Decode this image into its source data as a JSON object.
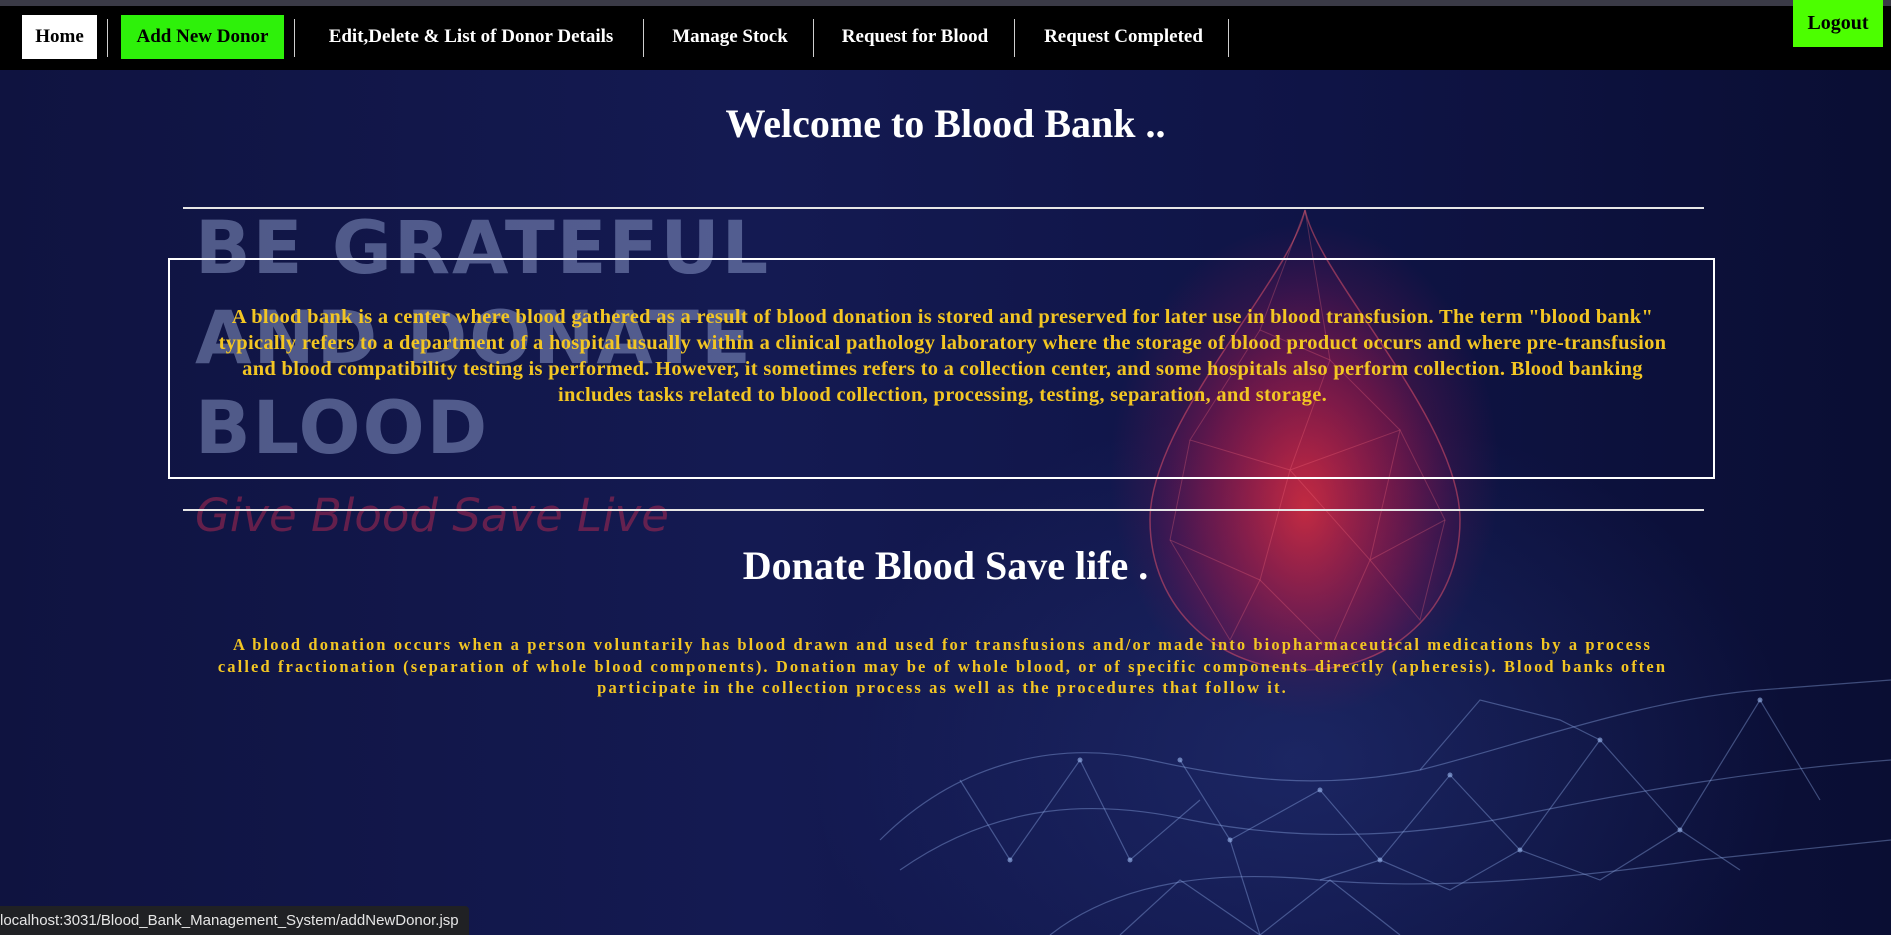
{
  "nav": {
    "home": "Home",
    "add_donor": "Add New Donor",
    "edit_donor": "Edit,Delete & List of Donor Details",
    "manage_stock": "Manage Stock",
    "request_blood": "Request for Blood",
    "request_completed": "Request Completed",
    "logout": "Logout"
  },
  "main": {
    "welcome_title": "Welcome to Blood Bank ..",
    "info_text": "A blood bank is a center where blood gathered as a result of blood donation is stored and preserved for later use in blood transfusion. The term \"blood bank\" typically refers to a department of a hospital usually within a clinical pathology laboratory where the storage of blood product occurs and where pre-transfusion and blood compatibility testing is performed. However, it sometimes refers to a collection center, and some hospitals also perform collection. Blood banking includes tasks related to blood collection, processing, testing, separation, and storage.",
    "donate_title": "Donate Blood Save life .",
    "donate_text": "A blood donation occurs when a person voluntarily has blood drawn and used for transfusions and/or made into biopharmaceutical medications by a process called fractionation (separation of whole blood components). Donation may be of whole blood, or of specific components directly (apheresis). Blood banks often participate in the collection process as well as the procedures that follow it."
  },
  "background": {
    "line1": "BE GRATEFUL",
    "line2": "AND DONATE",
    "line3": "BLOOD",
    "tagline": "Give Blood  Save Live"
  },
  "status": {
    "url": "localhost:3031/Blood_Bank_Management_System/addNewDonor.jsp"
  },
  "colors": {
    "nav_bg": "#000000",
    "home_bg": "#ffffff",
    "active_bg": "#2ef10a",
    "logout_bg": "#4cff00",
    "text_accent": "#f3c623"
  }
}
